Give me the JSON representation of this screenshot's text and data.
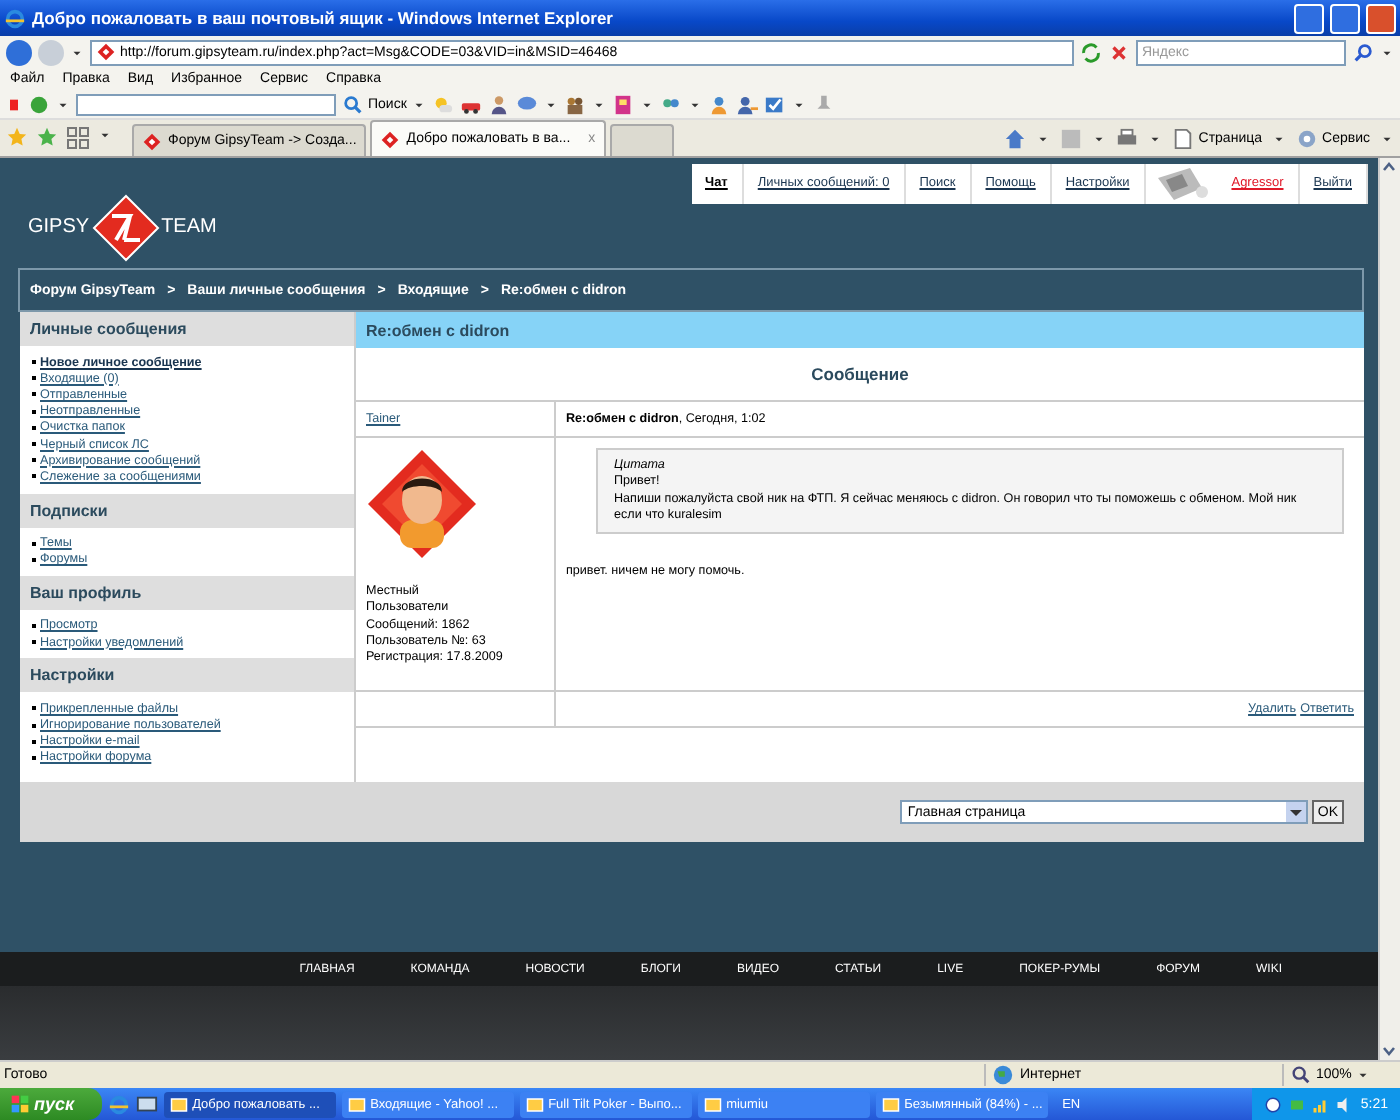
{
  "browser": {
    "title": "Добро пожаловать в ваш почтовый ящик - Windows Internet Explorer",
    "address": "http://forum.gipsyteam.ru/index.php?act=Msg&CODE=03&VID=in&MSID=46468",
    "search_placeholder": "Яндекс",
    "menu": [
      "Файл",
      "Правка",
      "Вид",
      "Избранное",
      "Сервис",
      "Справка"
    ],
    "toolbar_search": "Поиск",
    "tabs": [
      {
        "label": "Форум GipsyTeam -> Созда...",
        "selected": false
      },
      {
        "label": "Добро пожаловать в ва...",
        "selected": true
      }
    ],
    "tab_close": "x",
    "commands": [
      "Страница",
      "Сервис"
    ]
  },
  "site": {
    "logo": {
      "left": "GIPSY",
      "right": "TEAM"
    },
    "top_nav": [
      {
        "label": "Чат",
        "kind": "bold"
      },
      {
        "label": "Личных сообщений: 0",
        "kind": "link"
      },
      {
        "label": "Поиск",
        "kind": "link"
      },
      {
        "label": "Помощь",
        "kind": "link"
      },
      {
        "label": "Настройки",
        "kind": "link"
      },
      {
        "label": "Agressor",
        "kind": "user"
      },
      {
        "label": "Выйти",
        "kind": "link"
      }
    ],
    "breadcrumb": [
      "Форум GipsyTeam",
      "Ваши личные сообщения",
      "Входящие",
      "Re:обмен с didron"
    ],
    "breadcrumb_separator": ">",
    "sidebar": [
      {
        "title": "Личные сообщения",
        "primary_link": "Новое личное сообщение",
        "links": [
          "Входящие (0)",
          "Отправленные",
          "Неотправленные",
          "Очистка папок",
          "Черный список ЛС",
          "Архивирование сообщений",
          "Слежение за сообщениями"
        ]
      },
      {
        "title": "Подписки",
        "links": [
          "Темы",
          "Форумы"
        ]
      },
      {
        "title": "Ваш профиль",
        "links": [
          "Просмотр",
          "Настройки уведомлений"
        ]
      },
      {
        "title": "Настройки",
        "links": [
          "Прикрепленные файлы",
          "Игнорирование пользователей",
          "Настройки e-mail",
          "Настройки форума"
        ]
      }
    ],
    "panel_title": "Re:обмен с didron",
    "heading": "Сообщение",
    "post": {
      "author": "Tainer",
      "header": "**Re:обмен с didron**, Сегодня, 1:02",
      "author_info": [
        "Местный",
        "Пользователи",
        "Сообщений: 1862",
        "Пользователь №: 63",
        "Регистрация: 17.8.2009"
      ],
      "quote": {
        "label": "Цитата",
        "lines": [
          "Привет!",
          "Напиши пожалуйста свой ник на ФТП. Я сейчас меняюсь с didron. Он говорил что ты поможешь с обменом. Мой ник если что kuralesim"
        ]
      },
      "body": "привет. ничем не могу помочь.",
      "actions": [
        "Удалить",
        "Ответить"
      ]
    },
    "jump": {
      "value": "Главная страница",
      "button": "OK"
    },
    "footer_nav": [
      "ГЛАВНАЯ",
      "КОМАНДА",
      "НОВОСТИ",
      "БЛОГИ",
      "ВИДЕО",
      "СТАТЬИ",
      "LIVE",
      "ПОКЕР-РУМЫ",
      "ФОРУМ",
      "WIKI"
    ]
  },
  "status_bar": {
    "text": "Готово",
    "zone": "Интернет",
    "zoom": "100%"
  },
  "taskbar": {
    "start": "пуск",
    "tasks": [
      {
        "label": "Добро пожаловать ...",
        "selected": true
      },
      {
        "label": "Входящие - Yahoo! ...",
        "selected": false
      },
      {
        "label": "Full Tilt Poker - Выпо...",
        "selected": false
      },
      {
        "label": "miumiu",
        "selected": false
      },
      {
        "label": "Безымянный (84%) - ...",
        "selected": false
      }
    ],
    "language": "EN",
    "clock": "5:21"
  }
}
